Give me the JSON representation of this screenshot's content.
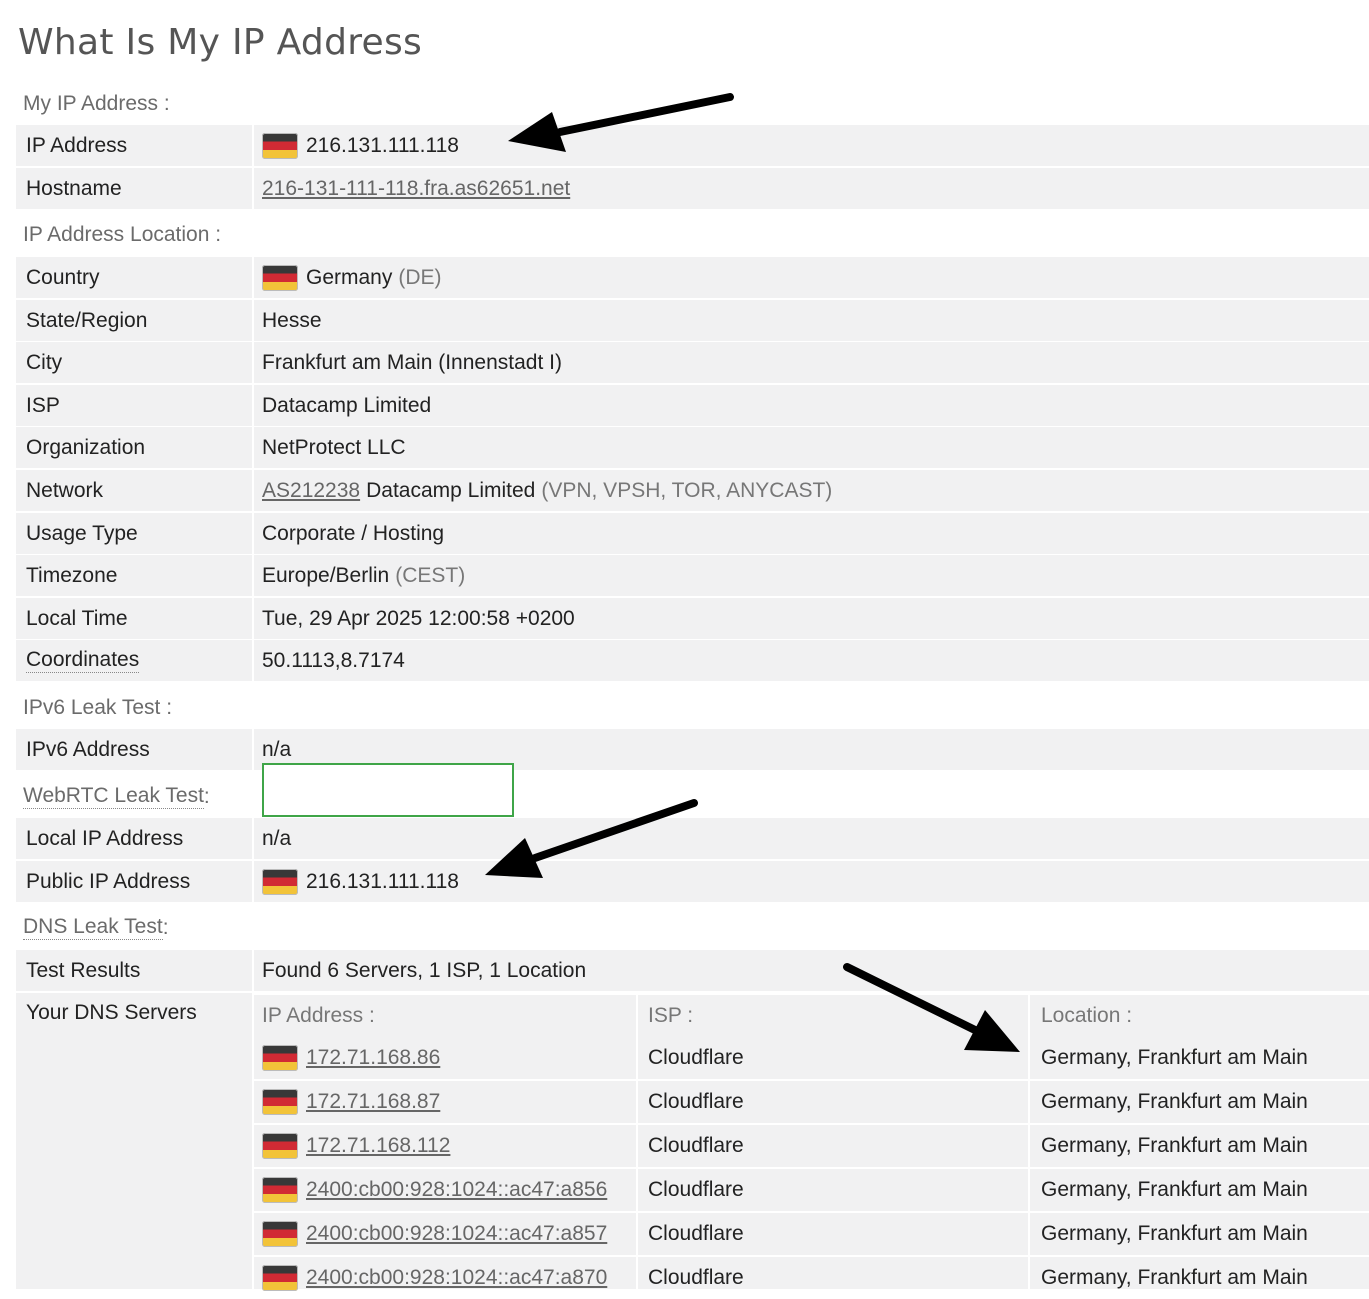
{
  "page_title": "What Is My IP Address",
  "sections": {
    "my_ip": "My IP Address :",
    "location": "IP Address Location :",
    "ipv6": "IPv6 Leak Test :",
    "webrtc": "WebRTC Leak Test",
    "webrtc_colon": " :",
    "dns": "DNS Leak Test",
    "dns_colon": " :"
  },
  "my_ip": {
    "ip_label": "IP Address",
    "ip_value": "216.131.111.118",
    "hostname_label": "Hostname",
    "hostname_value": "216-131-111-118.fra.as62651.net"
  },
  "location": {
    "country_label": "Country",
    "country_value": "Germany",
    "country_code": "(DE)",
    "region_label": "State/Region",
    "region_value": "Hesse",
    "city_label": "City",
    "city_value": "Frankfurt am Main (Innenstadt I)",
    "isp_label": "ISP",
    "isp_value": "Datacamp Limited",
    "org_label": "Organization",
    "org_value": "NetProtect LLC",
    "network_label": "Network",
    "network_asn": "AS212238",
    "network_name": "Datacamp Limited",
    "network_tags": "(VPN, VPSH, TOR, ANYCAST)",
    "usage_label": "Usage Type",
    "usage_value": "Corporate / Hosting",
    "timezone_label": "Timezone",
    "timezone_value": "Europe/Berlin",
    "timezone_abbr": "(CEST)",
    "localtime_label": "Local Time",
    "localtime_value": "Tue, 29 Apr 2025 12:00:58 +0200",
    "coords_label": "Coordinates",
    "coords_value": "50.1113,8.7174"
  },
  "ipv6": {
    "label": "IPv6 Address",
    "value": "n/a"
  },
  "webrtc": {
    "local_label": "Local IP Address",
    "local_value": "n/a",
    "public_label": "Public IP Address",
    "public_value": "216.131.111.118"
  },
  "dns": {
    "results_label": "Test Results",
    "results_value": "Found 6 Servers, 1 ISP, 1 Location",
    "servers_label": "Your DNS Servers",
    "headers": {
      "ip": "IP Address :",
      "isp": "ISP :",
      "location": "Location :"
    },
    "servers": [
      {
        "ip": "172.71.168.86",
        "isp": "Cloudflare",
        "location": "Germany, Frankfurt am Main"
      },
      {
        "ip": "172.71.168.87",
        "isp": "Cloudflare",
        "location": "Germany, Frankfurt am Main"
      },
      {
        "ip": "172.71.168.112",
        "isp": "Cloudflare",
        "location": "Germany, Frankfurt am Main"
      },
      {
        "ip": "2400:cb00:928:1024::ac47:a856",
        "isp": "Cloudflare",
        "location": "Germany, Frankfurt am Main"
      },
      {
        "ip": "2400:cb00:928:1024::ac47:a857",
        "isp": "Cloudflare",
        "location": "Germany, Frankfurt am Main"
      },
      {
        "ip": "2400:cb00:928:1024::ac47:a870",
        "isp": "Cloudflare",
        "location": "Germany, Frankfurt am Main"
      }
    ]
  },
  "flag_icon": "germany-flag-icon",
  "colors": {
    "row_bg": "#f1f1f2",
    "section_text": "#6b6b6b",
    "link": "#666666",
    "webrtc_box_border": "#3fa548",
    "annotation_arrow": "#000000"
  }
}
